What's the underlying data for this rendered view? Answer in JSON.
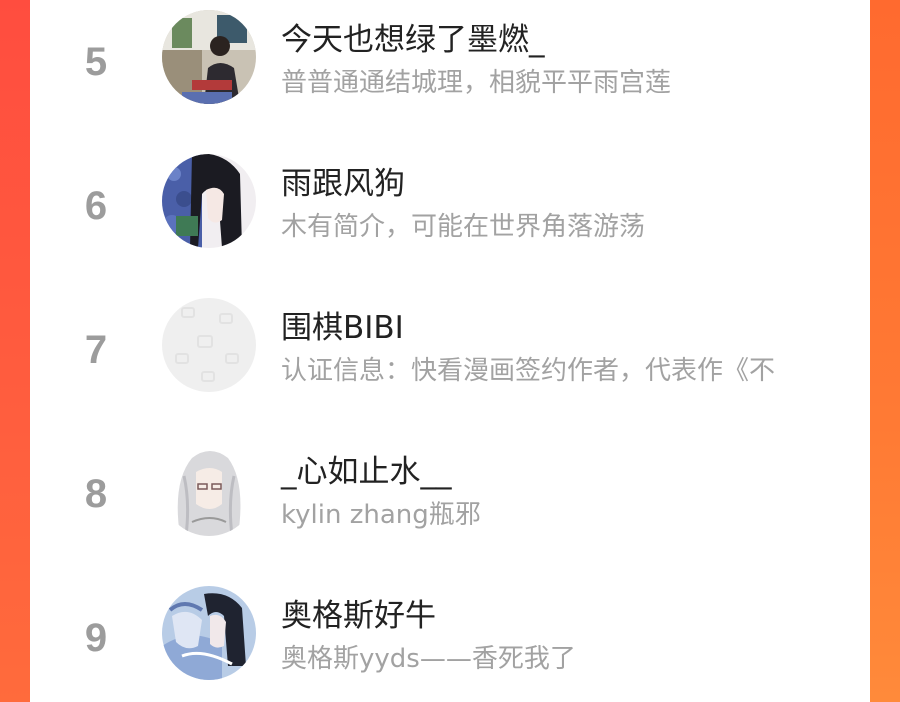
{
  "ranking": {
    "items": [
      {
        "rank": "5",
        "name": "今天也想绿了墨燃_",
        "bio": "普普通通结城理，相貌平平雨宫莲",
        "avatar": "painter-photo-avatar"
      },
      {
        "rank": "6",
        "name": "雨跟风狗",
        "bio": "木有简介，可能在世界角落游荡",
        "avatar": "anime-girl-dark-hair-avatar"
      },
      {
        "rank": "7",
        "name": "围棋BIBI",
        "bio": "认证信息：快看漫画签约作者，代表作《不",
        "avatar": "placeholder-avatar"
      },
      {
        "rank": "8",
        "name": "_心如止水__",
        "bio": "kylin zhang瓶邪",
        "avatar": "anime-white-hair-avatar"
      },
      {
        "rank": "9",
        "name": "奥格斯好牛",
        "bio": "奥格斯yyds——香死我了",
        "avatar": "anime-couple-blue-avatar"
      }
    ]
  },
  "colors": {
    "background_orange": "#ff6a3a",
    "rank_gray": "#9c9c9c",
    "name_text": "#222222",
    "bio_text": "#a2a2a2"
  }
}
